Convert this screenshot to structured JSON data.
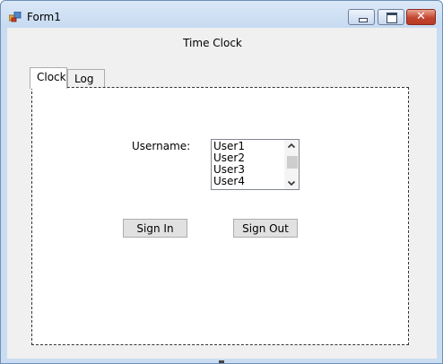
{
  "window": {
    "title": "Form1",
    "close_glyph": "✕"
  },
  "form": {
    "heading": "Time Clock"
  },
  "tabs": [
    {
      "label": "Clock",
      "active": true
    },
    {
      "label": "Log",
      "active": false
    }
  ],
  "clock": {
    "username_label": "Username:",
    "users": [
      "User1",
      "User2",
      "User3",
      "User4"
    ],
    "sign_in_label": "Sign In",
    "sign_out_label": "Sign Out"
  },
  "icons": {
    "app": "form-icon",
    "minimize": "minimize-icon",
    "maximize": "maximize-icon",
    "close": "close-icon",
    "scroll_up": "chevron-up-icon",
    "scroll_down": "chevron-down-icon"
  },
  "colors": {
    "close_button": "#c4452e",
    "titlebar": "#c6daf1",
    "client_bg": "#f0f0f0"
  }
}
